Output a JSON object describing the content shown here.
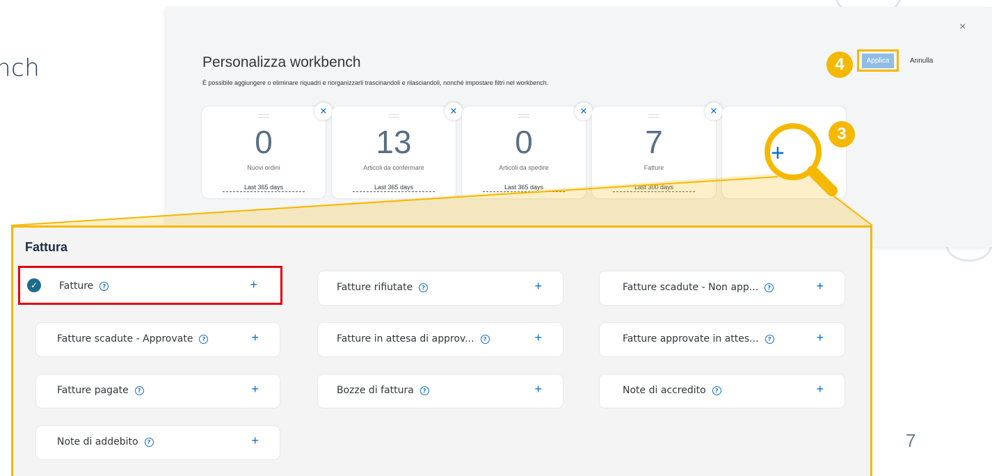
{
  "background": {
    "title": "nch",
    "page_number": "7"
  },
  "dialog": {
    "close_icon": "×",
    "title": "Personalizza workbench",
    "description": "È possibile aggiungere o eliminare riquadri e riorganizzarli trascinandoli e rilasciandoli, nonché impostare filtri nel workbench.",
    "apply_label": "Applica",
    "cancel_label": "Annulla",
    "tiles": [
      {
        "count": "0",
        "label": "Nuovi ordini",
        "range": "Last 365 days"
      },
      {
        "count": "13",
        "label": "Articoli da confermare",
        "range": "Last 365 days"
      },
      {
        "count": "0",
        "label": "Articoli da spedire",
        "range": "Last 365 days"
      },
      {
        "count": "7",
        "label": "Fatture",
        "range": "Last 300 days"
      }
    ],
    "add_tile_icon": "+"
  },
  "steps": {
    "badge_3": "3",
    "badge_4": "4"
  },
  "panel": {
    "section_title": "Fattura",
    "items": [
      {
        "label": "Fatture",
        "selected": true
      },
      {
        "label": "Fatture rifiutate"
      },
      {
        "label": "Fatture scadute - Non app..."
      },
      {
        "label": "Fatture scadute - Approvate"
      },
      {
        "label": "Fatture in attesa di approv..."
      },
      {
        "label": "Fatture approvate in attes..."
      },
      {
        "label": "Fatture pagate"
      },
      {
        "label": "Bozze di fattura"
      },
      {
        "label": "Note di accredito"
      },
      {
        "label": "Note di addebito"
      }
    ],
    "help_glyph": "?",
    "add_glyph": "+",
    "check_glyph": "✓"
  },
  "colors": {
    "highlight": "#f5b800",
    "selection_frame": "#e3000b",
    "accent": "#0a6ed1"
  }
}
